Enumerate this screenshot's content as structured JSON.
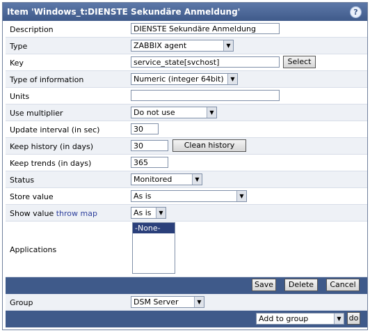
{
  "window": {
    "title": "Item 'Windows_t:DIENSTE Sekundäre Anmeldung'",
    "help_icon": "?"
  },
  "form": {
    "description": {
      "label": "Description",
      "value": "DIENSTE Sekundäre Anmeldung"
    },
    "type": {
      "label": "Type",
      "value": "ZABBIX agent"
    },
    "key": {
      "label": "Key",
      "value": "service_state[svchost]",
      "button": "Select"
    },
    "type_of_information": {
      "label": "Type of information",
      "value": "Numeric (integer 64bit)"
    },
    "units": {
      "label": "Units",
      "value": ""
    },
    "use_multiplier": {
      "label": "Use multiplier",
      "value": "Do not use"
    },
    "update_interval": {
      "label": "Update interval (in sec)",
      "value": "30"
    },
    "keep_history": {
      "label": "Keep history (in days)",
      "value": "30",
      "button": "Clean history"
    },
    "keep_trends": {
      "label": "Keep trends (in days)",
      "value": "365"
    },
    "status": {
      "label": "Status",
      "value": "Monitored"
    },
    "store_value": {
      "label": "Store value",
      "value": "As is"
    },
    "show_value": {
      "label": "Show value",
      "link": "throw map",
      "value": "As is"
    },
    "applications": {
      "label": "Applications",
      "options": [
        "-None-"
      ]
    }
  },
  "actions": {
    "save": "Save",
    "delete": "Delete",
    "cancel": "Cancel"
  },
  "group": {
    "label": "Group",
    "value": "DSM Server"
  },
  "footer": {
    "group_action": "Add to group",
    "do": "do"
  }
}
